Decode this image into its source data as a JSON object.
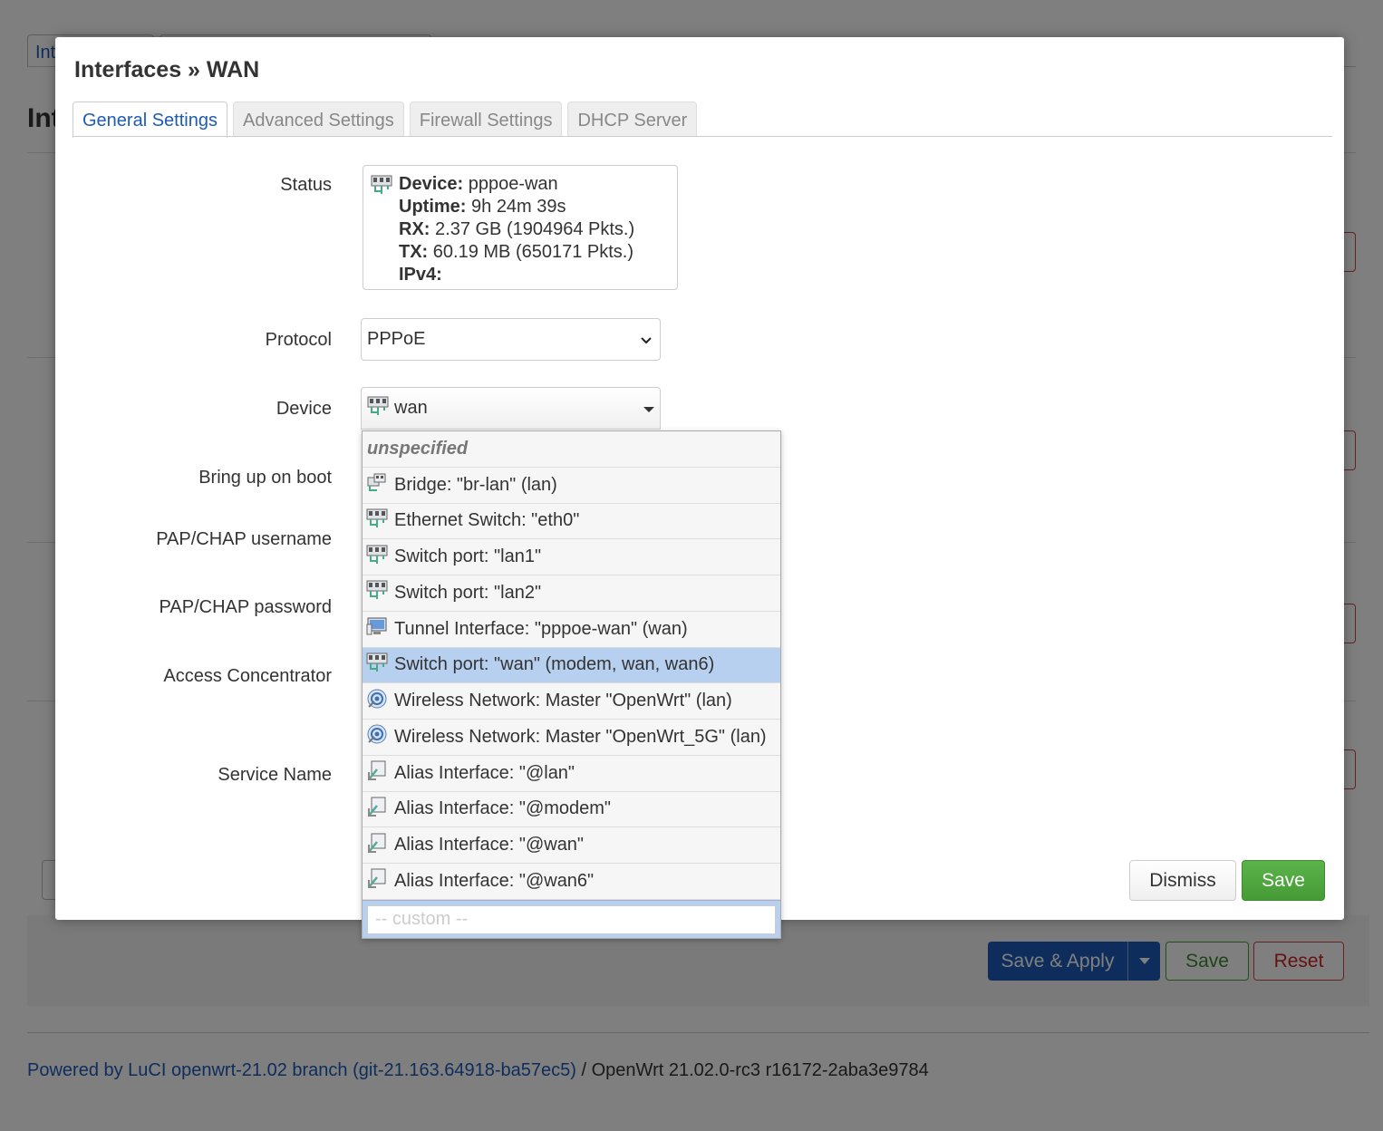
{
  "background": {
    "tab_fragment": "Int",
    "heading_fragment": "Int",
    "actions": {
      "save_apply": "Save & Apply",
      "save": "Save",
      "reset": "Reset"
    },
    "footer": {
      "link_text": "Powered by LuCI openwrt-21.02 branch (git-21.163.64918-ba57ec5)",
      "rest_text": " / OpenWrt 21.02.0-rc3 r16172-2aba3e9784"
    }
  },
  "modal": {
    "title": "Interfaces » WAN",
    "tabs": [
      {
        "label": "General Settings",
        "active": true
      },
      {
        "label": "Advanced Settings",
        "active": false
      },
      {
        "label": "Firewall Settings",
        "active": false
      },
      {
        "label": "DHCP Server",
        "active": false
      }
    ],
    "fields": {
      "status_label": "Status",
      "protocol_label": "Protocol",
      "device_label": "Device",
      "bring_up_label": "Bring up on boot",
      "username_label": "PAP/CHAP username",
      "password_label": "PAP/CHAP password",
      "access_conc_label": "Access Concentrator",
      "service_name_label": "Service Name"
    },
    "status": {
      "device_key": "Device:",
      "device_val": " pppoe-wan",
      "uptime_key": "Uptime:",
      "uptime_val": " 9h 24m 39s",
      "rx_key": "RX:",
      "rx_val": " 2.37 GB (1904964 Pkts.)",
      "tx_key": "TX:",
      "tx_val": " 60.19 MB (650171 Pkts.)",
      "ipv4_key": "IPv4:"
    },
    "protocol_value": "PPPoE",
    "device_value": "wan",
    "dismiss_label": "Dismiss",
    "save_label": "Save"
  },
  "device_dropdown": {
    "unspecified": "unspecified",
    "items": [
      {
        "label": "Bridge: \"br-lan\" (lan)",
        "icon": "bridge-icon",
        "selected": false
      },
      {
        "label": "Ethernet Switch: \"eth0\"",
        "icon": "ethernet-icon",
        "selected": false
      },
      {
        "label": "Switch port: \"lan1\"",
        "icon": "ethernet-icon",
        "selected": false
      },
      {
        "label": "Switch port: \"lan2\"",
        "icon": "ethernet-icon",
        "selected": false
      },
      {
        "label": "Tunnel Interface: \"pppoe-wan\" (wan)",
        "icon": "tunnel-icon",
        "selected": false
      },
      {
        "label": "Switch port: \"wan\" (modem, wan, wan6)",
        "icon": "ethernet-icon",
        "selected": true
      },
      {
        "label": "Wireless Network: Master \"OpenWrt\" (lan)",
        "icon": "wireless-icon",
        "selected": false
      },
      {
        "label": "Wireless Network: Master \"OpenWrt_5G\" (lan)",
        "icon": "wireless-icon",
        "selected": false
      },
      {
        "label": "Alias Interface: \"@lan\"",
        "icon": "alias-icon",
        "selected": false
      },
      {
        "label": "Alias Interface: \"@modem\"",
        "icon": "alias-icon",
        "selected": false
      },
      {
        "label": "Alias Interface: \"@wan\"",
        "icon": "alias-icon",
        "selected": false
      },
      {
        "label": "Alias Interface: \"@wan6\"",
        "icon": "alias-icon",
        "selected": false
      }
    ],
    "custom_placeholder": "-- custom --"
  }
}
